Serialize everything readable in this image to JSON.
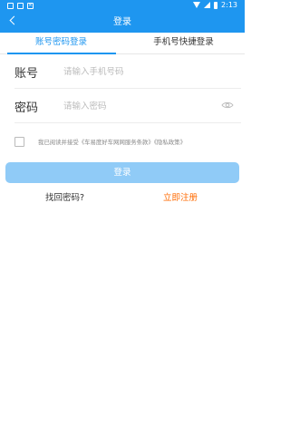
{
  "status_bar": {
    "left_badges": [
      "",
      "",
      "✕"
    ],
    "time": "2:13"
  },
  "header": {
    "title": "登录"
  },
  "tabs": [
    {
      "label": "账号密码登录",
      "active": true
    },
    {
      "label": "手机号快捷登录",
      "active": false
    }
  ],
  "form": {
    "account": {
      "label": "账号",
      "placeholder": "请输入手机号码",
      "value": ""
    },
    "password": {
      "label": "密码",
      "placeholder": "请输入密码",
      "value": ""
    }
  },
  "agreement": {
    "checked": false,
    "text": "我已阅读并接受《车易度好车网网服务条款》《隐私政策》"
  },
  "actions": {
    "login_label": "登录",
    "forgot_label": "找回密码?",
    "register_label": "立即注册"
  },
  "colors": {
    "primary": "#1e96f0",
    "login_button_disabled": "#90cbf7",
    "register_link": "#ff6a00"
  },
  "icons": {
    "back": "chevron-left-icon",
    "password_visibility": "eye-icon"
  }
}
